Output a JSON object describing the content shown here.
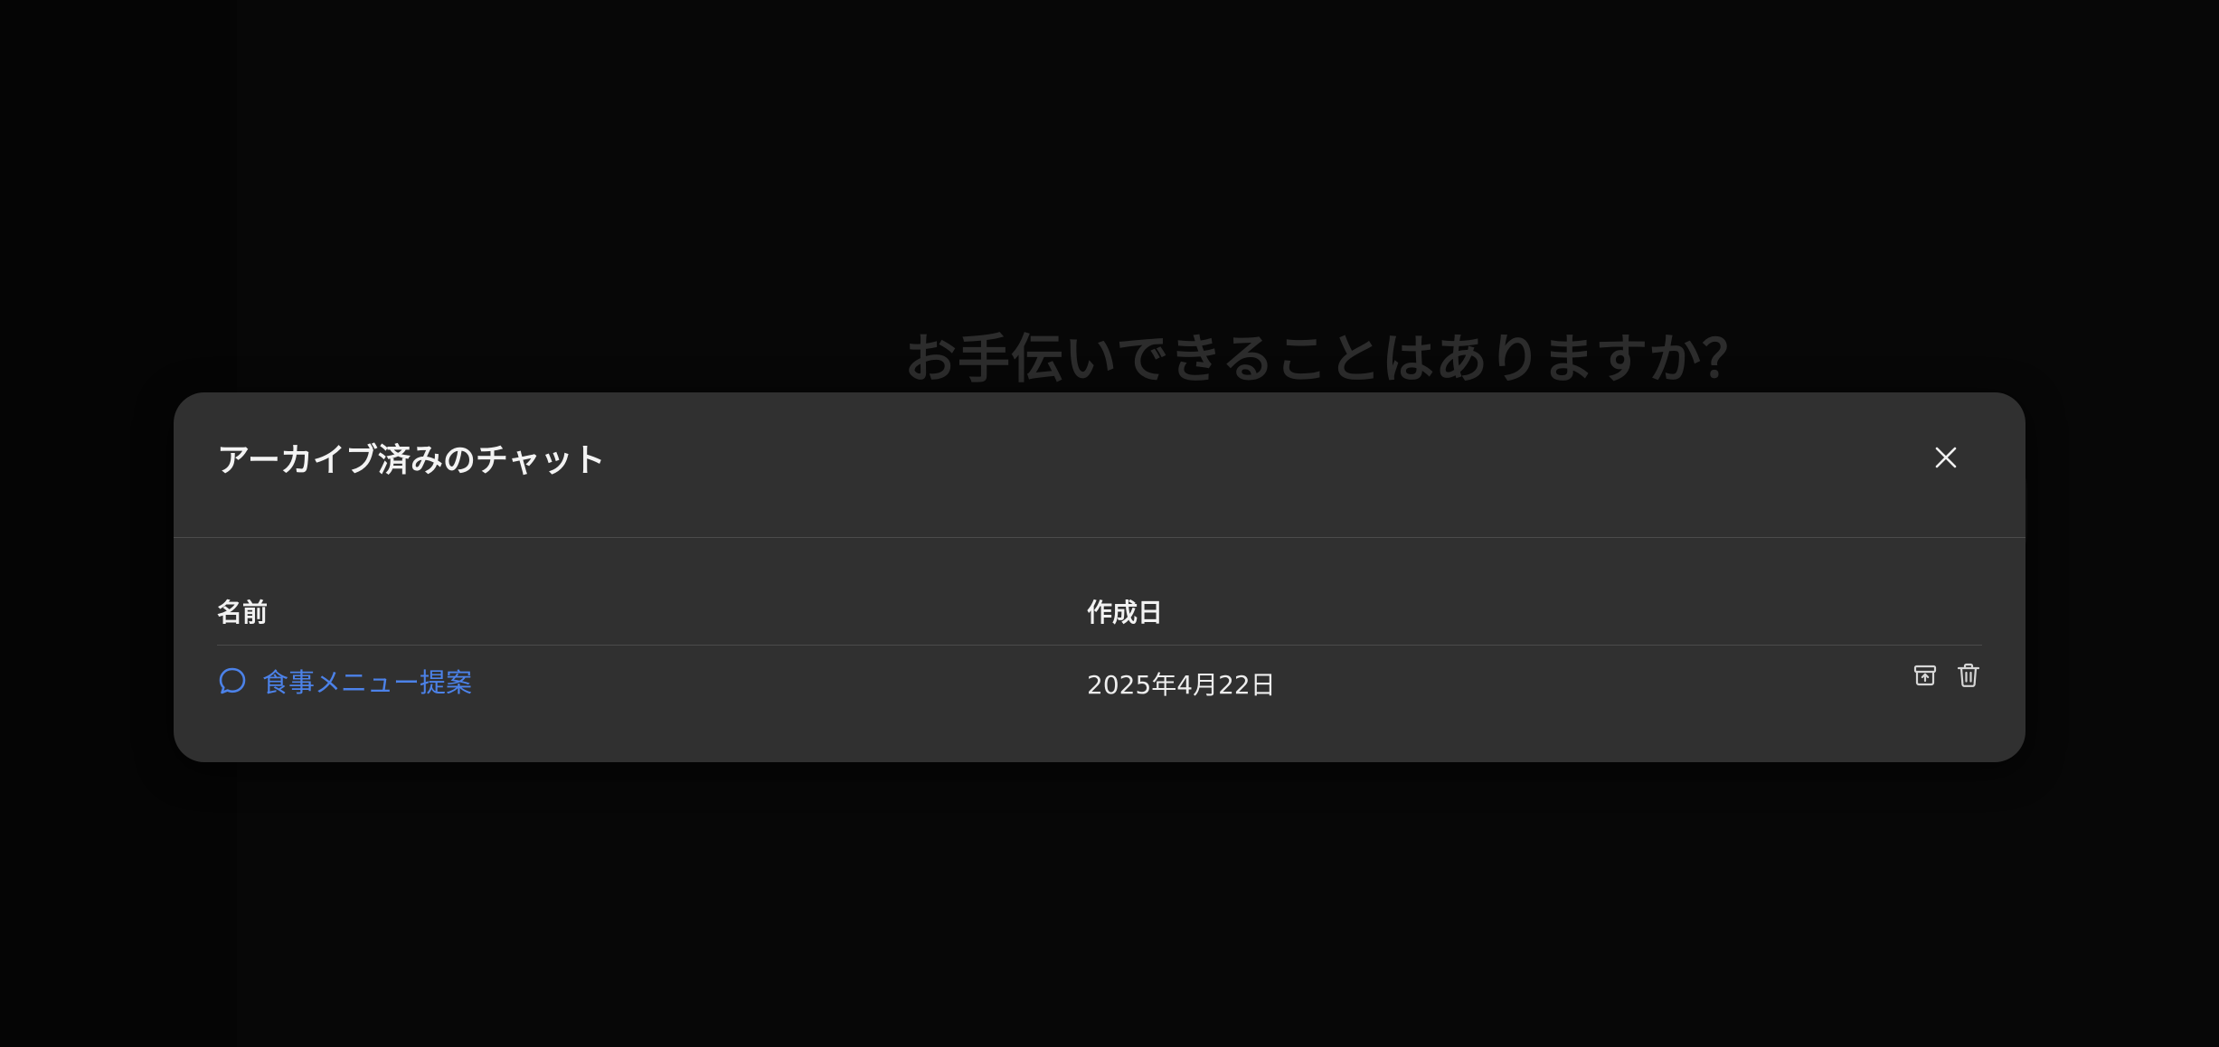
{
  "background": {
    "heading": "お手伝いできることはありますか？"
  },
  "modal": {
    "title": "アーカイブ済みのチャット",
    "close_icon": "close-icon",
    "columns": {
      "name": "名前",
      "created": "作成日"
    },
    "rows": [
      {
        "title": "食事メニュー提案",
        "created": "2025年4月22日",
        "icon": "chat-bubble-icon",
        "actions": [
          "unarchive-icon",
          "trash-icon"
        ]
      }
    ]
  },
  "colors": {
    "background": "#070707",
    "modal": "#303030",
    "link": "#4c82e9",
    "text": "#f2f2f2"
  }
}
